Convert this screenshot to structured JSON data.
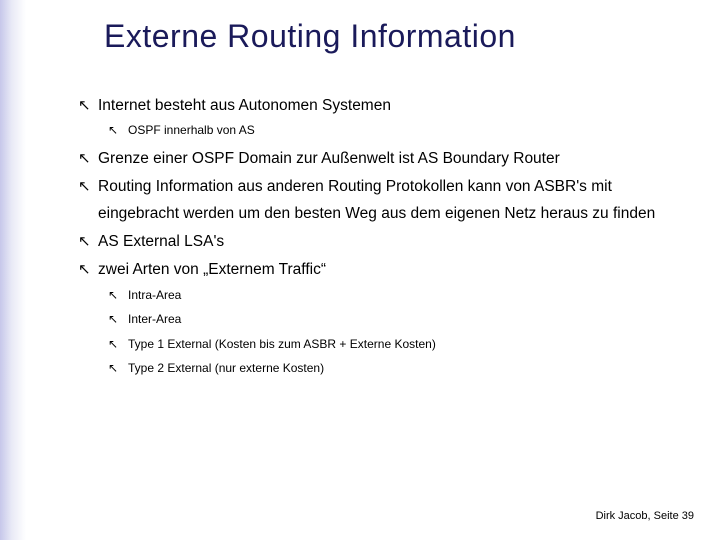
{
  "title": "Externe Routing Information",
  "bullets": {
    "l1_0": "Internet besteht aus Autonomen Systemen",
    "l2_0": "OSPF innerhalb von AS",
    "l1_1": "Grenze einer OSPF Domain zur Außenwelt ist AS Boundary Router",
    "l1_2": "Routing Information aus anderen Routing Protokollen kann von ASBR's mit eingebracht werden um den besten Weg aus dem eigenen Netz heraus zu finden",
    "l1_3": "AS External LSA's",
    "l1_4": "zwei Arten von „Externem Traffic“",
    "l2_1": "Intra-Area",
    "l2_2": "Inter-Area",
    "l2_3": "Type 1 External (Kosten bis zum ASBR + Externe Kosten)",
    "l2_4": "Type 2 External (nur externe Kosten)"
  },
  "footer": "Dirk Jacob, Seite 39",
  "glyphs": {
    "arrow": "↖"
  }
}
